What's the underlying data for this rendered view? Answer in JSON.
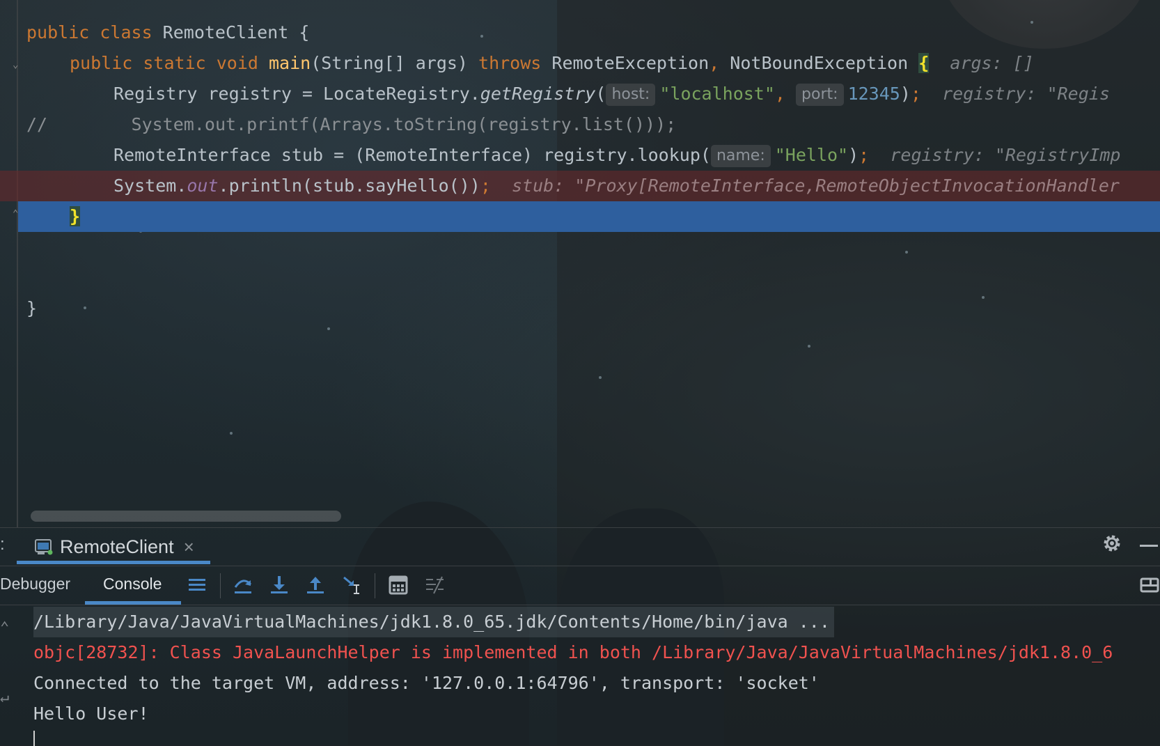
{
  "editor": {
    "lines": [
      {
        "id": "l1",
        "tokens": [
          [
            "k",
            "public class "
          ],
          [
            "",
            "RemoteClient {"
          ]
        ]
      },
      {
        "id": "l2"
      },
      {
        "id": "l3"
      },
      {
        "id": "l4"
      },
      {
        "id": "l5"
      },
      {
        "id": "l6"
      },
      {
        "id": "l7"
      }
    ],
    "line1": {
      "kw": "public class ",
      "name": "RemoteClient {"
    },
    "line2": {
      "kw1": "public static void ",
      "method": "main",
      "params": "(String[] args) ",
      "kw2": "throws",
      "exc1": " RemoteException",
      "comma": ",",
      "exc2": " NotBoundException ",
      "brace": "{",
      "inlay": "args: []"
    },
    "line3": {
      "pre": "Registry registry = LocateRegistry.",
      "method": "getRegistry",
      "paren": "(",
      "hint_host": "host:",
      "str_host": "\"localhost\"",
      "comma": ",",
      "hint_port": "port:",
      "num_port": "12345",
      "close": ")",
      "semi": ";",
      "inlay": "registry: \"Regis"
    },
    "line4": {
      "slashes": "//",
      "rest": "System.out.printf(Arrays.toString(registry.list()));"
    },
    "line5": {
      "pre": "RemoteInterface stub = (RemoteInterface) registry.lookup(",
      "hint_name": "name:",
      "str": "\"Hello\"",
      "close": ")",
      "semi": ";",
      "inlay": "registry: \"RegistryImp"
    },
    "line6": {
      "pre": "System.",
      "field": "out",
      "post": ".println(stub.sayHello())",
      "semi": ";",
      "inlay": "stub: \"Proxy[RemoteInterface,RemoteObjectInvocationHandler"
    },
    "line7": {
      "brace": "}"
    },
    "line8": {
      "brace": "}"
    }
  },
  "debug_window": {
    "header_prefix": ":",
    "session_tab": {
      "label": "RemoteClient",
      "close": "×",
      "icon": "console-window-icon"
    },
    "tabs": [
      "Debugger",
      "Console"
    ],
    "active_tab": "Console",
    "toolbar_icons": [
      "threads-menu-icon",
      "step-over-icon",
      "step-into-icon",
      "step-out-icon",
      "run-to-cursor-icon",
      "evaluate-expression-icon",
      "trace-icon"
    ],
    "right_icons": [
      "gear-icon",
      "minimize-icon",
      "layout-icon"
    ]
  },
  "console": {
    "line1": "/Library/Java/JavaVirtualMachines/jdk1.8.0_65.jdk/Contents/Home/bin/java ...",
    "line2": "objc[28732]: Class JavaLaunchHelper is implemented in both /Library/Java/JavaVirtualMachines/jdk1.8.0_6",
    "line3": "Connected to the target VM, address: '127.0.0.1:64796', transport: 'socket'",
    "line4": "Hello User!"
  },
  "colors": {
    "keyword": "#cc7832",
    "method": "#ffc66d",
    "string": "#7aa35e",
    "number": "#6897bb",
    "current_line": "#2e5f9e",
    "breakpoint_line": "#6e282a",
    "error_text": "#f0524f",
    "accent": "#4a88c7"
  }
}
